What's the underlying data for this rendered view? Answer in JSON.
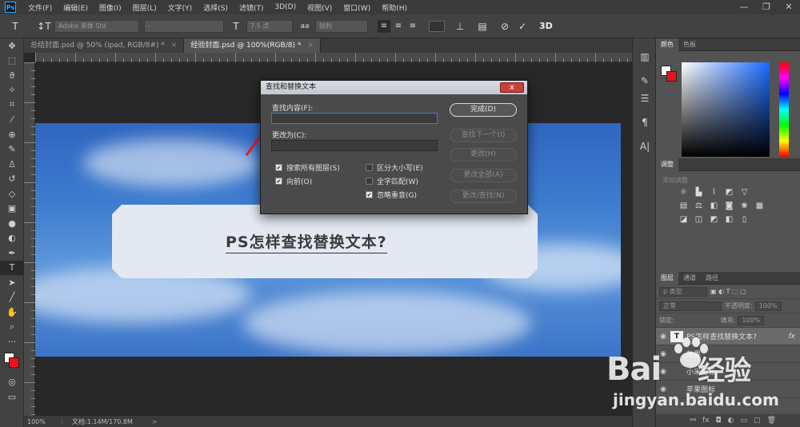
{
  "app": {
    "logo": "Ps",
    "menu": [
      "文件(F)",
      "编辑(E)",
      "图像(I)",
      "图层(L)",
      "文字(Y)",
      "选择(S)",
      "滤镜(T)",
      "3D(D)",
      "视图(V)",
      "窗口(W)",
      "帮助(H)"
    ]
  },
  "options_bar": {
    "font_family": "Adobe 黑体 Std",
    "font_style": "-",
    "font_size": "7.5 点",
    "antialias_icon": "aa",
    "antialias": "锐利",
    "mode_3d": "3D"
  },
  "tabs": [
    {
      "label": "总结封面.psd @ 50% (ipad, RGB/8#) *",
      "close": "×"
    },
    {
      "label": "经验封面.psd @ 100%(RGB/8) *",
      "close": "×"
    }
  ],
  "canvas": {
    "card_text": "PS怎样查找替换文本?"
  },
  "status": {
    "zoom": "100%",
    "doc_info": "文档:1.14M/170.8M",
    "arrow": ">"
  },
  "dialog": {
    "title": "查找和替换文本",
    "close": "x",
    "find_label": "查找内容(F):",
    "find_value": "",
    "replace_label": "更改为(C):",
    "replace_value": "",
    "options": [
      {
        "label": "搜索所有图层(S)",
        "checked": true
      },
      {
        "label": "向前(O)",
        "checked": true
      },
      {
        "label": "区分大小写(E)",
        "checked": false
      },
      {
        "label": "全字匹配(W)",
        "checked": false
      },
      {
        "label": "忽略重音(G)",
        "checked": true
      }
    ],
    "buttons": {
      "done": "完成(D)",
      "find_next": "查找下一个(I)",
      "change": "更改(H)",
      "change_all": "更改全部(A)",
      "change_find": "更改/查找(N)"
    }
  },
  "panels": {
    "color_tabs": [
      "颜色",
      "色板"
    ],
    "adjust_title": "调整",
    "adjust_add": "添加调整",
    "layer_tabs": [
      "图层",
      "通道",
      "路径"
    ],
    "kind": "ρ 类型",
    "blend": "正常",
    "opacity_label": "不透明度:",
    "opacity": "100%",
    "lock_label": "锁定:",
    "fill_label": "填充:",
    "fill": "100%",
    "layers": [
      {
        "name": "PS怎样查找替换文本?",
        "fx": "fx",
        "selected": true
      },
      {
        "name": "效果",
        "fx": "",
        "selected": false
      },
      {
        "name": "小米图标",
        "fx": "",
        "selected": false
      },
      {
        "name": "苹果图标",
        "fx": "",
        "selected": false
      }
    ]
  },
  "watermark": {
    "brand": "Bai",
    "brand2": "经验",
    "url": "jingyan.baidu.com"
  },
  "colors": {
    "foreground": "#ffffff",
    "background": "#e8141a",
    "accent": "#3c7bd8"
  }
}
